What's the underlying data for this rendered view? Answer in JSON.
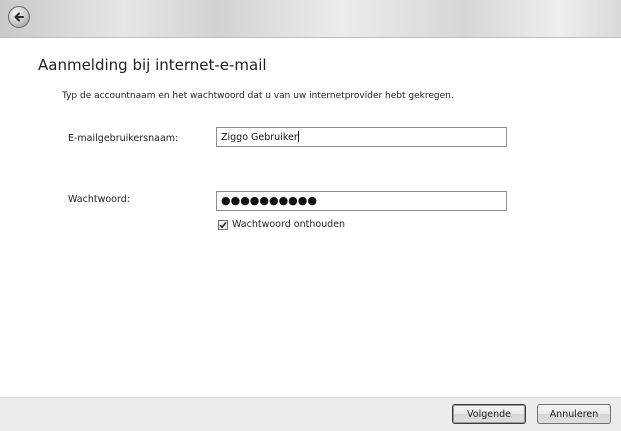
{
  "header": {
    "back_icon": "back-arrow-icon"
  },
  "title": "Aanmelding bij internet-e-mail",
  "instruction": "Typ de accountnaam en het wachtwoord dat u van uw internetprovider hebt gekregen.",
  "username": {
    "label": "E-mailgebruikersnaam:",
    "value": "Ziggo Gebruiker"
  },
  "password": {
    "label": "Wachtwoord:",
    "value": "●●●●●●●●●●"
  },
  "remember": {
    "label": "Wachtwoord onthouden",
    "checked": true
  },
  "footer": {
    "next_label": "Volgende",
    "cancel_label": "Annuleren"
  }
}
